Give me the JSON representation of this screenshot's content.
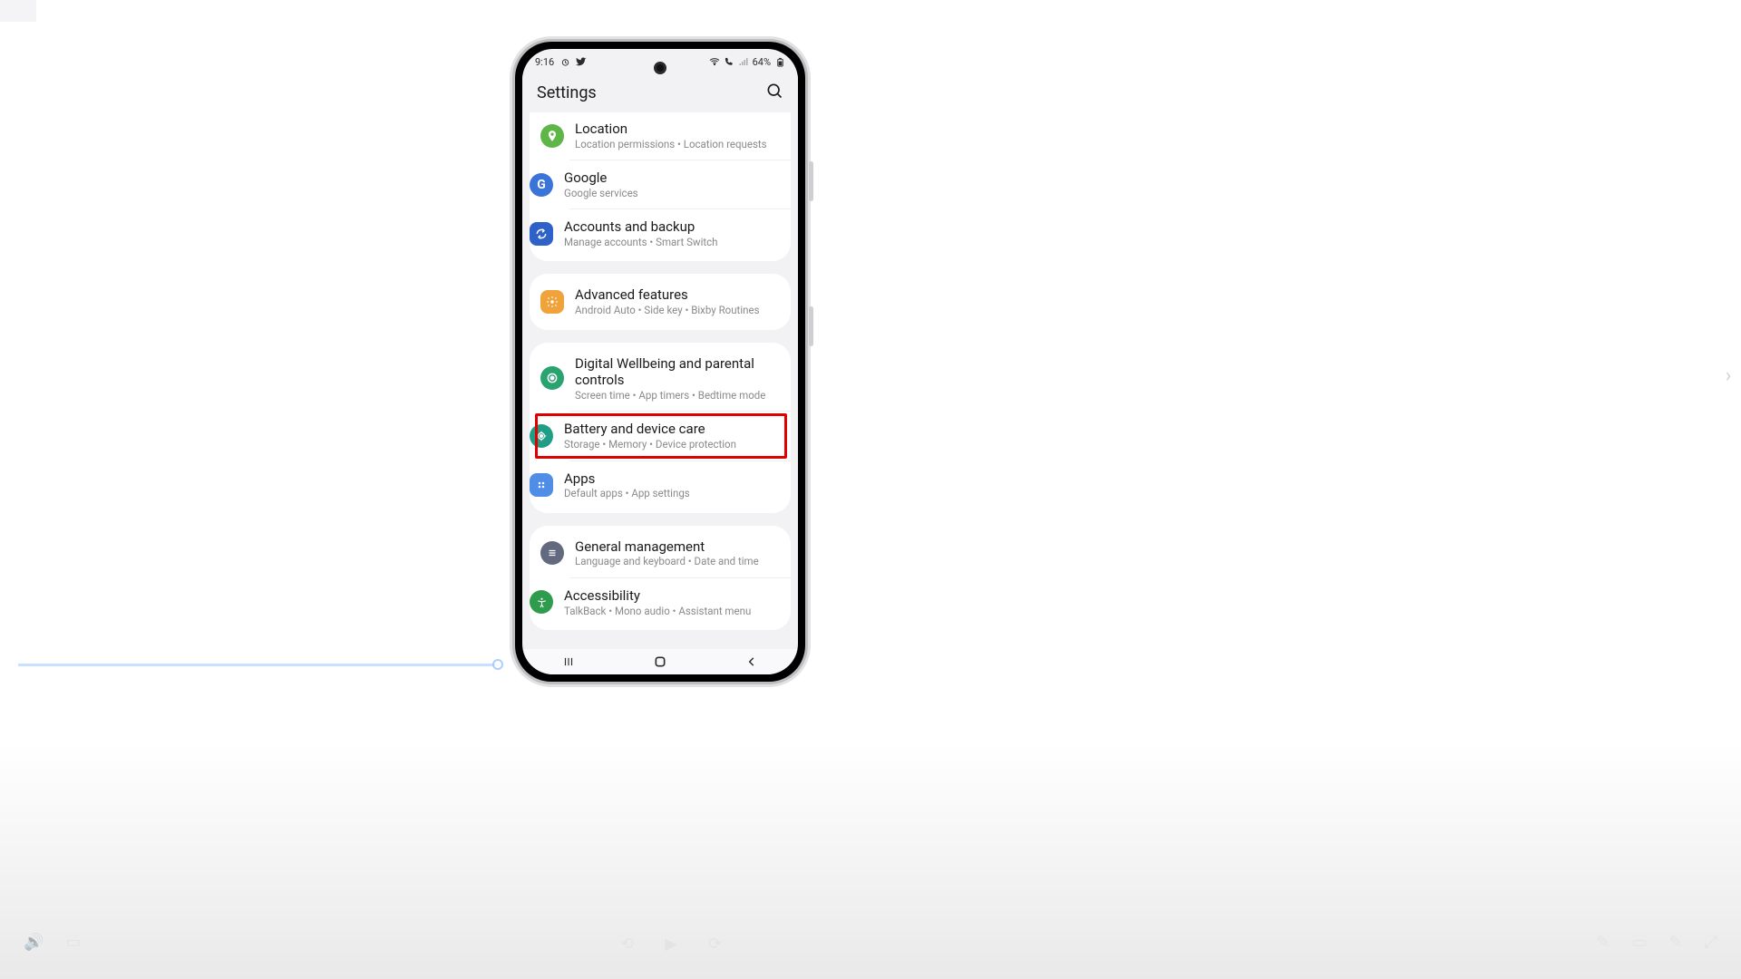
{
  "status": {
    "time": "9:16",
    "battery_text": "64%"
  },
  "header": {
    "title": "Settings"
  },
  "groups": [
    {
      "rows": [
        {
          "title": "Location",
          "subtitle": "Location permissions  •  Location requests"
        },
        {
          "title": "Google",
          "subtitle": "Google services"
        },
        {
          "title": "Accounts and backup",
          "subtitle": "Manage accounts  •  Smart Switch"
        }
      ]
    },
    {
      "rows": [
        {
          "title": "Advanced features",
          "subtitle": "Android Auto  •  Side key  •  Bixby Routines"
        }
      ]
    },
    {
      "rows": [
        {
          "title": "Digital Wellbeing and parental controls",
          "subtitle": "Screen time  •  App timers  •  Bedtime mode"
        },
        {
          "title": "Battery and device care",
          "subtitle": "Storage  •  Memory  •  Device protection"
        },
        {
          "title": "Apps",
          "subtitle": "Default apps  •  App settings"
        }
      ]
    },
    {
      "rows": [
        {
          "title": "General management",
          "subtitle": "Language and keyboard  •  Date and time"
        },
        {
          "title": "Accessibility",
          "subtitle": "TalkBack  •  Mono audio  •  Assistant menu"
        }
      ]
    }
  ]
}
